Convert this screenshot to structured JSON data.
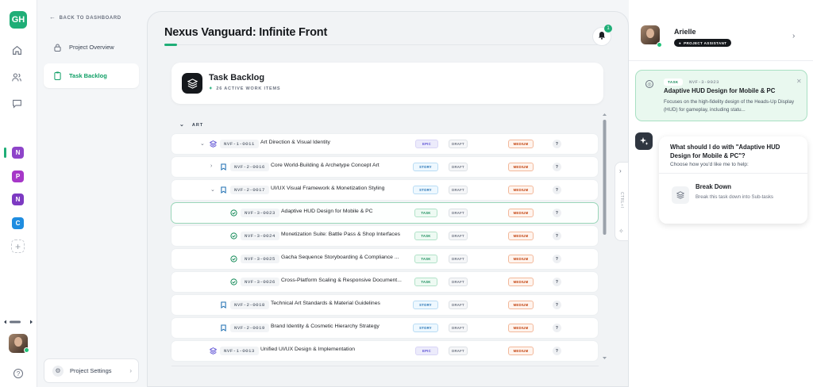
{
  "rail": {
    "logo": "GH",
    "workspaces": [
      {
        "letter": "N",
        "color": "#8e44c9"
      },
      {
        "letter": "P",
        "color": "#a637c8"
      },
      {
        "letter": "N",
        "color": "#7d3ac2"
      },
      {
        "letter": "C",
        "color": "#1f8de0"
      }
    ],
    "add": "+",
    "help": "?"
  },
  "nav": {
    "back": "BACK TO DASHBOARD",
    "items": [
      {
        "label": "Project Overview"
      },
      {
        "label": "Task Backlog"
      }
    ],
    "settings": "Project Settings"
  },
  "header": {
    "title": "Nexus Vanguard: Infinite Front",
    "notifications": "1"
  },
  "backlog": {
    "title": "Task Backlog",
    "subtitle": "26 ACTIVE WORK ITEMS"
  },
  "group": {
    "label": "ART"
  },
  "rows": [
    {
      "id": "NVF-1-0011",
      "title": "Art Direction & Visual Identity",
      "type": "EPIC",
      "status": "DRAFT",
      "priority": "MEDIUM",
      "assignee": "?"
    },
    {
      "id": "NVF-2-0016",
      "title": "Core World-Building & Archetype Concept Art",
      "type": "STORY",
      "status": "DRAFT",
      "priority": "MEDIUM",
      "assignee": "?"
    },
    {
      "id": "NVF-2-0017",
      "title": "UI/UX Visual Framework & Monetization Styling",
      "type": "STORY",
      "status": "DRAFT",
      "priority": "MEDIUM",
      "assignee": "?"
    },
    {
      "id": "NVF-3-0023",
      "title": "Adaptive HUD Design for Mobile & PC",
      "type": "TASK",
      "status": "DRAFT",
      "priority": "MEDIUM",
      "assignee": "?"
    },
    {
      "id": "NVF-3-0024",
      "title": "Monetization Suite: Battle Pass & Shop Interfaces",
      "type": "TASK",
      "status": "DRAFT",
      "priority": "MEDIUM",
      "assignee": "?"
    },
    {
      "id": "NVF-3-0025",
      "title": "Gacha Sequence Storyboarding & Compliance ...",
      "type": "TASK",
      "status": "DRAFT",
      "priority": "MEDIUM",
      "assignee": "?"
    },
    {
      "id": "NVF-3-0026",
      "title": "Cross-Platform Scaling & Responsive Document...",
      "type": "TASK",
      "status": "DRAFT",
      "priority": "MEDIUM",
      "assignee": "?"
    },
    {
      "id": "NVF-2-0018",
      "title": "Technical Art Standards & Material Guidelines",
      "type": "STORY",
      "status": "DRAFT",
      "priority": "MEDIUM",
      "assignee": "?"
    },
    {
      "id": "NVF-2-0019",
      "title": "Brand Identity & Cosmetic Hierarchy Strategy",
      "type": "STORY",
      "status": "DRAFT",
      "priority": "MEDIUM",
      "assignee": "?"
    },
    {
      "id": "NVF-1-0013",
      "title": "Unified UI/UX Design & Implementation",
      "type": "EPIC",
      "status": "DRAFT",
      "priority": "MEDIUM",
      "assignee": "?"
    }
  ],
  "sidebar_handle": {
    "shortcut": "CTRL+I"
  },
  "assistant": {
    "name": "Arielle",
    "role": "PROJECT ASSISTANT",
    "task": {
      "tag": "TASK",
      "id": "NVF-3-0023",
      "title": "Adaptive HUD Design for Mobile & PC",
      "description": "Focuses on the high-fidelity design of the Heads-Up Display (HUD) for gameplay, including statu..."
    },
    "question": "What should I do with \"Adaptive HUD Design for Mobile & PC\"?",
    "hint": "Choose how you'd like me to help:",
    "option": {
      "title": "Break Down",
      "description": "Break this task down into Sub-tasks"
    }
  }
}
